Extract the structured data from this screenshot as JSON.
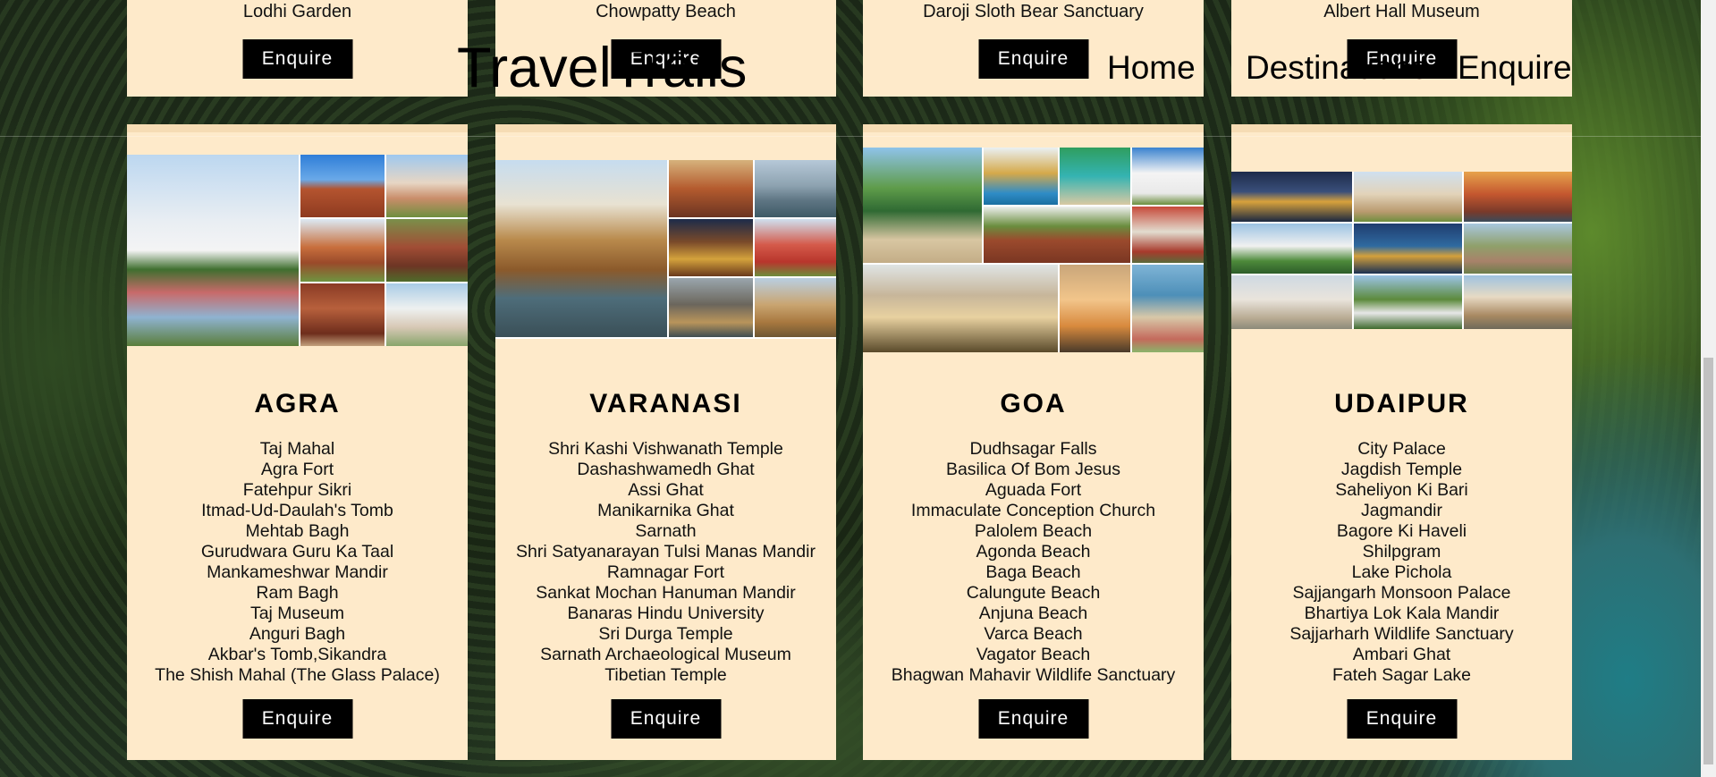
{
  "header": {
    "brand": "TravelTrails",
    "nav": {
      "home": "Home",
      "destinations": "Destinations",
      "enquire": "Enquire"
    }
  },
  "top_row": [
    {
      "title": "Lodhi Garden",
      "button": "Enquire"
    },
    {
      "title": "Chowpatty Beach",
      "button": "Enquire"
    },
    {
      "title": "Daroji Sloth Bear Sanctuary",
      "button": "Enquire"
    },
    {
      "title": "Albert Hall Museum",
      "button": "Enquire"
    }
  ],
  "cards": [
    {
      "city": "AGRA",
      "places": [
        "Taj Mahal",
        "Agra Fort",
        "Fatehpur Sikri",
        "Itmad-Ud-Daulah's Tomb",
        "Mehtab Bagh",
        "Gurudwara Guru Ka Taal",
        "Mankameshwar Mandir",
        "Ram Bagh",
        "Taj Museum",
        "Anguri Bagh",
        "Akbar's Tomb,Sikandra",
        "The Shish Mahal (The Glass Palace)"
      ],
      "button": "Enquire"
    },
    {
      "city": "VARANASI",
      "places": [
        "Shri Kashi Vishwanath Temple",
        "Dashashwamedh Ghat",
        "Assi Ghat",
        "Manikarnika Ghat",
        "Sarnath",
        "Shri Satyanarayan Tulsi Manas Mandir",
        "Ramnagar Fort",
        "Sankat Mochan Hanuman Mandir",
        "Banaras Hindu University",
        "Sri Durga Temple",
        "Sarnath Archaeological Museum",
        "Tibetian Temple"
      ],
      "button": "Enquire"
    },
    {
      "city": "GOA",
      "places": [
        "Dudhsagar Falls",
        "Basilica Of Bom Jesus",
        "Aguada Fort",
        "Immaculate Conception Church",
        "Palolem Beach",
        "Agonda Beach",
        "Baga Beach",
        "Calungute Beach",
        "Anjuna Beach",
        "Varca Beach",
        "Vagator Beach",
        "Bhagwan Mahavir Wildlife Sanctuary"
      ],
      "button": "Enquire"
    },
    {
      "city": "UDAIPUR",
      "places": [
        "City Palace",
        "Jagdish Temple",
        "Saheliyon Ki Bari",
        "Jagmandir",
        "Bagore Ki Haveli",
        "Shilpgram",
        "Lake Pichola",
        "Sajjangarh Monsoon Palace",
        "Bhartiya Lok Kala Mandir",
        "Sajjarharh Wildlife Sanctuary",
        "Ambari Ghat",
        "Fateh Sagar Lake"
      ],
      "button": "Enquire"
    }
  ],
  "colors": {
    "card": "#feeaca",
    "button": "#000000"
  }
}
